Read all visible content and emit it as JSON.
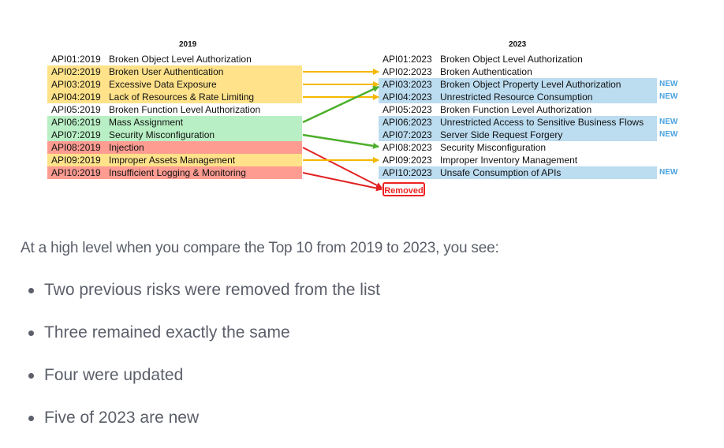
{
  "diagram": {
    "left_year": "2019",
    "right_year": "2023",
    "left_items": [
      {
        "code": "API01:2019",
        "title": "Broken Object Level Authorization",
        "color": "#ffffff"
      },
      {
        "code": "API02:2019",
        "title": "Broken User Authentication",
        "color": "#ffe28a"
      },
      {
        "code": "API03:2019",
        "title": "Excessive Data Exposure",
        "color": "#ffe28a"
      },
      {
        "code": "API04:2019",
        "title": "Lack of Resources & Rate Limiting",
        "color": "#ffe28a"
      },
      {
        "code": "API05:2019",
        "title": "Broken Function Level Authorization",
        "color": "#ffffff"
      },
      {
        "code": "API06:2019",
        "title": "Mass Assignment",
        "color": "#b8efc4"
      },
      {
        "code": "API07:2019",
        "title": "Security Misconfiguration",
        "color": "#b8efc4"
      },
      {
        "code": "API08:2019",
        "title": "Injection",
        "color": "#ff9c92"
      },
      {
        "code": "API09:2019",
        "title": "Improper Assets Management",
        "color": "#ffe28a"
      },
      {
        "code": "API10:2019",
        "title": "Insufficient Logging & Monitoring",
        "color": "#ff9c92"
      }
    ],
    "right_items": [
      {
        "code": "API01:2023",
        "title": "Broken Object Level Authorization",
        "color": "#ffffff",
        "new": ""
      },
      {
        "code": "API02:2023",
        "title": "Broken Authentication",
        "color": "#ffffff",
        "new": ""
      },
      {
        "code": "API03:2023",
        "title": "Broken Object Property Level Authorization",
        "color": "#bcdcf0",
        "new": "NEW"
      },
      {
        "code": "API04:2023",
        "title": "Unrestricted Resource Consumption",
        "color": "#bcdcf0",
        "new": "NEW"
      },
      {
        "code": "API05:2023",
        "title": "Broken Function Level Authorization",
        "color": "#ffffff",
        "new": ""
      },
      {
        "code": "API06:2023",
        "title": "Unrestricted Access to Sensitive Business Flows",
        "color": "#bcdcf0",
        "new": "NEW"
      },
      {
        "code": "API07:2023",
        "title": "Server Side Request Forgery",
        "color": "#bcdcf0",
        "new": "NEW"
      },
      {
        "code": "API08:2023",
        "title": "Security Misconfiguration",
        "color": "#ffffff",
        "new": ""
      },
      {
        "code": "API09:2023",
        "title": "Improper Inventory Management",
        "color": "#ffffff",
        "new": ""
      },
      {
        "code": "API10:2023",
        "title": "Unsafe Consumption of APIs",
        "color": "#bcdcf0",
        "new": "NEW"
      }
    ],
    "removed_label": "Removed",
    "arrow_colors": {
      "yellow": "#f5b800",
      "green": "#4caf2a",
      "red": "#e22222"
    }
  },
  "article": {
    "summary": "At a high level when you compare the Top 10 from 2019 to 2023, you see:",
    "bullets": [
      "Two previous risks were removed from the list",
      "Three remained exactly the same",
      "Four were updated",
      "Five of 2023 are new"
    ]
  }
}
